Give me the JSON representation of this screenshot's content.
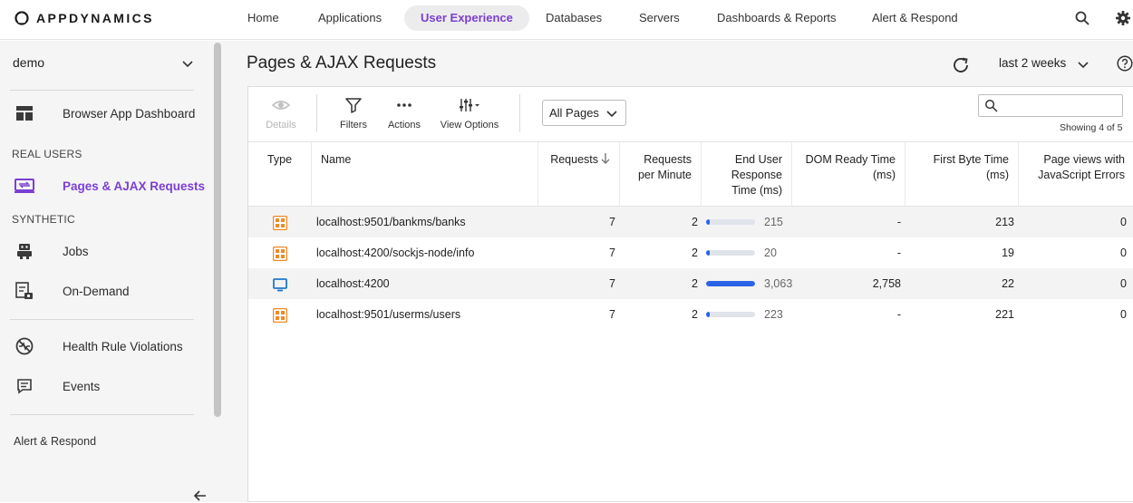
{
  "brand": {
    "name": "APPDYNAMICS"
  },
  "nav": {
    "items": [
      {
        "label": "Home"
      },
      {
        "label": "Applications"
      },
      {
        "label": "User Experience",
        "active": true
      },
      {
        "label": "Databases"
      },
      {
        "label": "Servers"
      },
      {
        "label": "Dashboards & Reports"
      },
      {
        "label": "Alert & Respond"
      }
    ],
    "icons": [
      "search-icon",
      "gear-icon"
    ]
  },
  "sidebar": {
    "app_selector": {
      "value": "demo"
    },
    "items": [
      {
        "label": "Browser App Dashboard",
        "icon": "dashboard-icon"
      },
      {
        "label": "Pages & AJAX Requests",
        "icon": "ajax-icon",
        "active": true
      },
      {
        "label": "Jobs",
        "icon": "robot-icon"
      },
      {
        "label": "On-Demand",
        "icon": "on-demand-icon"
      },
      {
        "label": "Health Rule Violations",
        "icon": "health-violation-icon"
      },
      {
        "label": "Events",
        "icon": "events-icon"
      }
    ],
    "sections": {
      "real_users": "REAL USERS",
      "synthetic": "SYNTHETIC"
    },
    "footer": "Alert & Respond"
  },
  "main": {
    "title": "Pages & AJAX Requests",
    "time_range": "last 2 weeks",
    "toolbar": {
      "details": "Details",
      "filters": "Filters",
      "actions": "Actions",
      "view_options": "View Options",
      "page_filter": "All Pages",
      "search_placeholder": "",
      "showing": "Showing 4 of 5"
    },
    "columns": {
      "type": "Type",
      "name": "Name",
      "requests": "Requests",
      "requests_per_minute_1": "Requests",
      "requests_per_minute_2": "per Minute",
      "end_user_1": "End User",
      "end_user_2": "Response",
      "end_user_3": "Time (ms)",
      "dom_ready_1": "DOM Ready Time",
      "dom_ready_2": "(ms)",
      "first_byte_1": "First Byte Time",
      "first_byte_2": "(ms)",
      "js_errors_1": "Page views with",
      "js_errors_2": "JavaScript Errors"
    },
    "rows": [
      {
        "type": "ajax",
        "name": "localhost:9501/bankms/banks",
        "requests": "7",
        "rpm": "2",
        "eurt": "215",
        "eurt_fraction": 0.07,
        "dom": "-",
        "fbt": "213",
        "js_errors": "0"
      },
      {
        "type": "ajax",
        "name": "localhost:4200/sockjs-node/info",
        "requests": "7",
        "rpm": "2",
        "eurt": "20",
        "eurt_fraction": 0.01,
        "dom": "-",
        "fbt": "19",
        "js_errors": "0"
      },
      {
        "type": "page",
        "name": "localhost:4200",
        "requests": "7",
        "rpm": "2",
        "eurt": "3,063",
        "eurt_fraction": 1.0,
        "dom": "2,758",
        "fbt": "22",
        "js_errors": "0"
      },
      {
        "type": "ajax",
        "name": "localhost:9501/userms/users",
        "requests": "7",
        "rpm": "2",
        "eurt": "223",
        "eurt_fraction": 0.07,
        "dom": "-",
        "fbt": "221",
        "js_errors": "0"
      }
    ]
  },
  "colors": {
    "accent": "#7b3fd1",
    "ajax": "#f08a24",
    "page": "#1f7ac9",
    "bar": "#2b63e6"
  }
}
